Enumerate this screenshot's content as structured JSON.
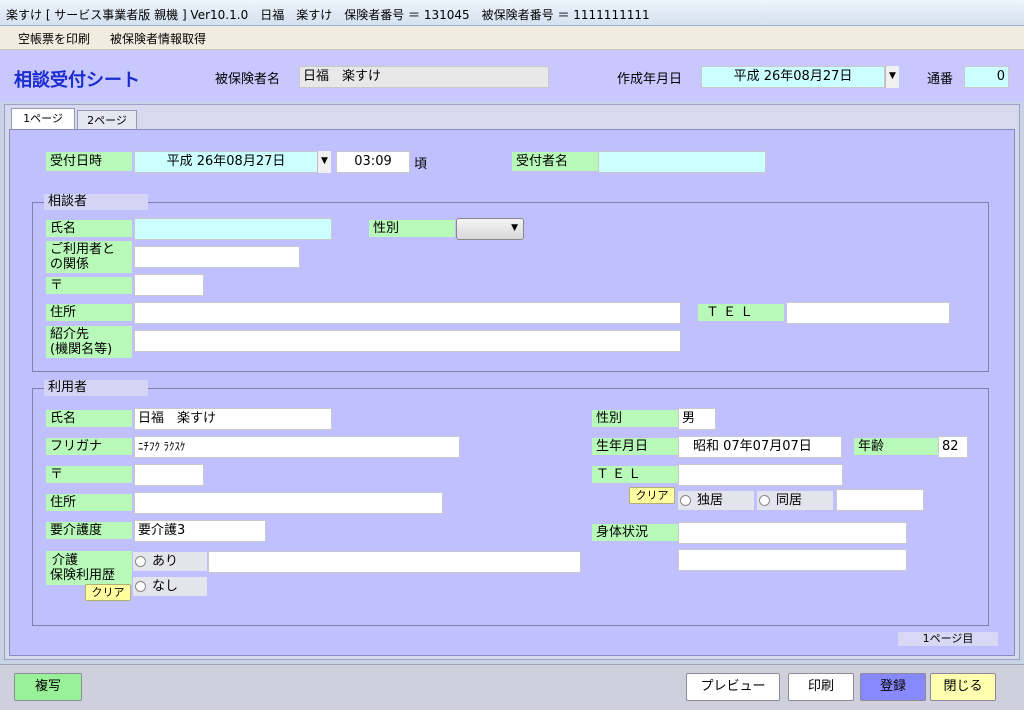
{
  "window": {
    "title": "楽すけ [ サービス事業者版 親機 ] Ver10.1.0　日福　楽すけ　保険者番号 ＝ 131045　被保険者番号 ＝ 1111111111"
  },
  "menu": {
    "items": [
      "空帳票を印刷",
      "被保険者情報取得"
    ]
  },
  "header": {
    "app_title": "相談受付シート",
    "insured_name_label": "被保険者名",
    "insured_name": "日福　楽すけ",
    "created_date_label": "作成年月日",
    "created_date": "平成 26年08月27日",
    "serial_label": "通番",
    "serial": "0"
  },
  "tabs": [
    "1ページ",
    "2ページ"
  ],
  "reception": {
    "datetime_label": "受付日時",
    "date": "平成 26年08月27日",
    "time": "03:09",
    "time_suffix": "頃",
    "receiver_label": "受付者名",
    "receiver": ""
  },
  "consultant": {
    "group_title": "相談者",
    "name_label": "氏名",
    "name": "",
    "gender_label": "性別",
    "gender": "",
    "relation_label_1": "ご利用者と",
    "relation_label_2": "の関係",
    "relation": "",
    "zip_label": "〒",
    "zip": "",
    "address_label": "住所",
    "address": "",
    "tel_label": "ＴＥＬ",
    "tel": "",
    "referral_label_1": "紹介先",
    "referral_label_2": "(機関名等)",
    "referral": ""
  },
  "user": {
    "group_title": "利用者",
    "name_label": "氏名",
    "name": "日福　楽すけ",
    "kana_label": "フリガナ",
    "kana": "ﾆﾁﾌｸ ﾗｸｽｹ",
    "zip_label": "〒",
    "zip": "",
    "address_label": "住所",
    "address": "",
    "care_level_label": "要介護度",
    "care_level": "要介護3",
    "history_label_1": "介護",
    "history_label_2": "保険利用歴",
    "history_yes": "あり",
    "history_no": "なし",
    "history_note": "",
    "clear_label": "クリア",
    "gender_label": "性別",
    "gender": "男",
    "birth_label": "生年月日",
    "birth": "昭和 07年07月07日",
    "age_label": "年齢",
    "age": "82",
    "tel_label": "ＴＥＬ",
    "tel": "",
    "living_alone": "独居",
    "living_with": "同居",
    "living_note": "",
    "physical_label": "身体状況",
    "physical_1": "",
    "physical_2": ""
  },
  "page_indicator": "1ページ目",
  "footer": {
    "copy": "複写",
    "preview": "プレビュー",
    "print": "印刷",
    "register": "登録",
    "close": "閉じる"
  }
}
